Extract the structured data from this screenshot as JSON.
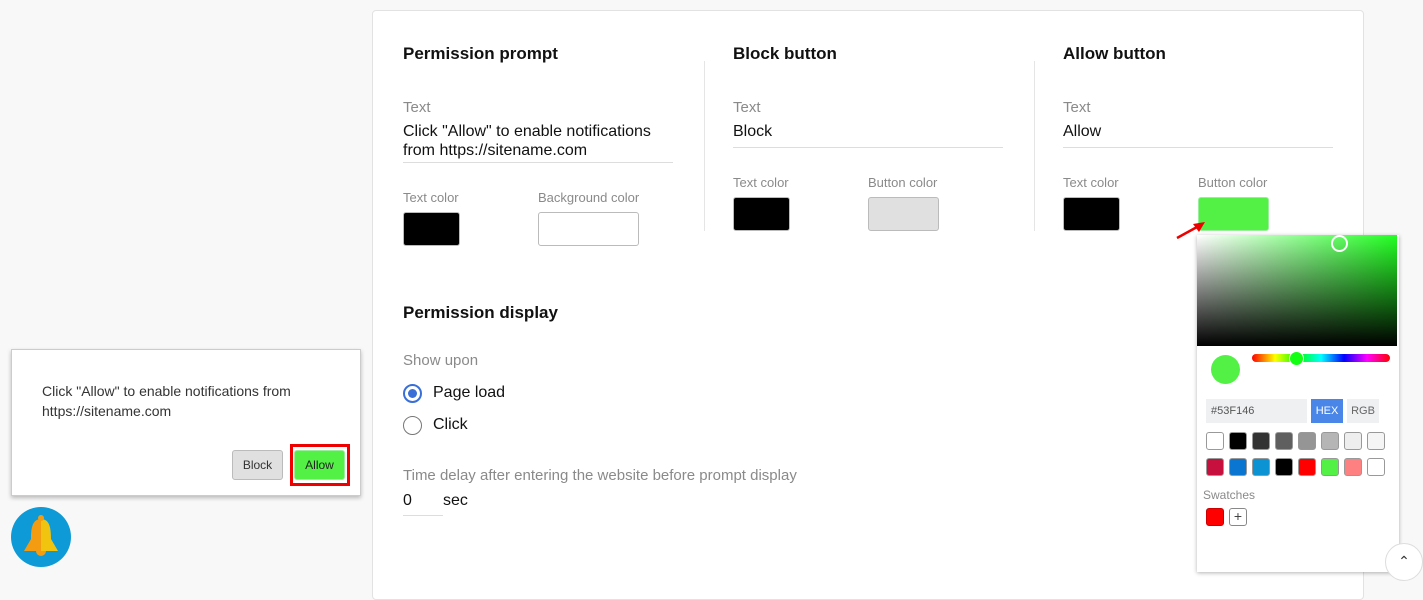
{
  "prompt": {
    "title": "Permission prompt",
    "text_label": "Text",
    "text_value": "Click \"Allow\" to enable notifications from https://sitename.com",
    "text_color_label": "Text color",
    "bg_color_label": "Background color",
    "text_color": "#000000",
    "bg_color": "#ffffff"
  },
  "block": {
    "title": "Block button",
    "text_label": "Text",
    "text_value": "Block",
    "text_color_label": "Text color",
    "button_color_label": "Button color",
    "text_color": "#000000",
    "button_color": "#e0e0e0"
  },
  "allow": {
    "title": "Allow button",
    "text_label": "Text",
    "text_value": "Allow",
    "text_color_label": "Text color",
    "button_color_label": "Button color",
    "text_color": "#000000",
    "button_color": "#53F146"
  },
  "display": {
    "title": "Permission display",
    "show_upon_label": "Show upon",
    "options": [
      "Page load",
      "Click"
    ],
    "selected": "Page load",
    "delay_label": "Time delay after entering the website before prompt display",
    "delay_value": "0",
    "delay_unit": "sec"
  },
  "picker": {
    "hex_value": "#53F146",
    "mode_hex": "HEX",
    "mode_rgb": "RGB",
    "active_mode": "HEX",
    "presets": [
      "#ffffff",
      "#000000",
      "#333333",
      "#5f5f5f",
      "#959595",
      "#b5b5b5",
      "#eeeeee",
      "#f5f5f5",
      "#c8103e",
      "#0b76d1",
      "#0b93d3",
      "#000000",
      "#ff0000",
      "#53f146",
      "#ff8080",
      "#ffffff"
    ],
    "swatches_label": "Swatches",
    "swatches": [
      "#ff0000"
    ],
    "add_label": "+"
  },
  "preview": {
    "text": "Click \"Allow\" to enable notifications from https://sitename.com",
    "block_label": "Block",
    "allow_label": "Allow"
  }
}
